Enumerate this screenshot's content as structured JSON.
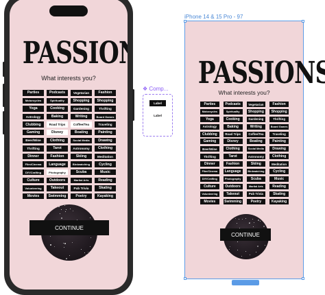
{
  "app": {
    "title": "PASSIONS",
    "subtitle": "What interests you?",
    "continue_label": "CONTINUE"
  },
  "selected_interests": [
    "Road Trips",
    "Coffee/Tea",
    "Disney",
    "Photography"
  ],
  "interests": [
    "Parties",
    "Podcasts",
    "Vegetarian",
    "Fashion",
    "Motorcycles",
    "Spirituality",
    "Shopping",
    "Shopping",
    "Yoga",
    "Cooking",
    "Gardening",
    "Thrifting",
    "Astrology",
    "Baking",
    "Writing",
    "Board Games",
    "Clubbing",
    "Road Trips",
    "Coffee/Tea",
    "Traveling",
    "Gaming",
    "Disney",
    "Boating",
    "Painting",
    "Beer/Wine",
    "Clothing",
    "Social Media",
    "Drawing",
    "Thrifting",
    "Tarot",
    "Astronomy",
    "Clothing",
    "Dinner",
    "Fashion",
    "Skiing",
    "Meditation",
    "Film/Cinema",
    "Language",
    "Birdwatching",
    "Cycling",
    "DIY/Crafting",
    "Photography",
    "Scuba",
    "Music",
    "Culture",
    "Outdoors",
    "Martial Arts",
    "Reading",
    "Volunteering",
    "Takeout",
    "Pub Trivia",
    "Skating",
    "Movies",
    "Swimming",
    "Poetry",
    "Kayaking"
  ],
  "frame": {
    "label": "iPhone 14 & 15 Pro - 97"
  },
  "component_set": {
    "label": "Comp...",
    "variants": [
      "Label",
      "Label"
    ]
  },
  "colors": {
    "background_pink": "#f1d6d9",
    "chip": "#111111",
    "chip_text": "#ffffff",
    "selection_blue": "#5b9be6",
    "component_purple": "#8b5cf6"
  }
}
